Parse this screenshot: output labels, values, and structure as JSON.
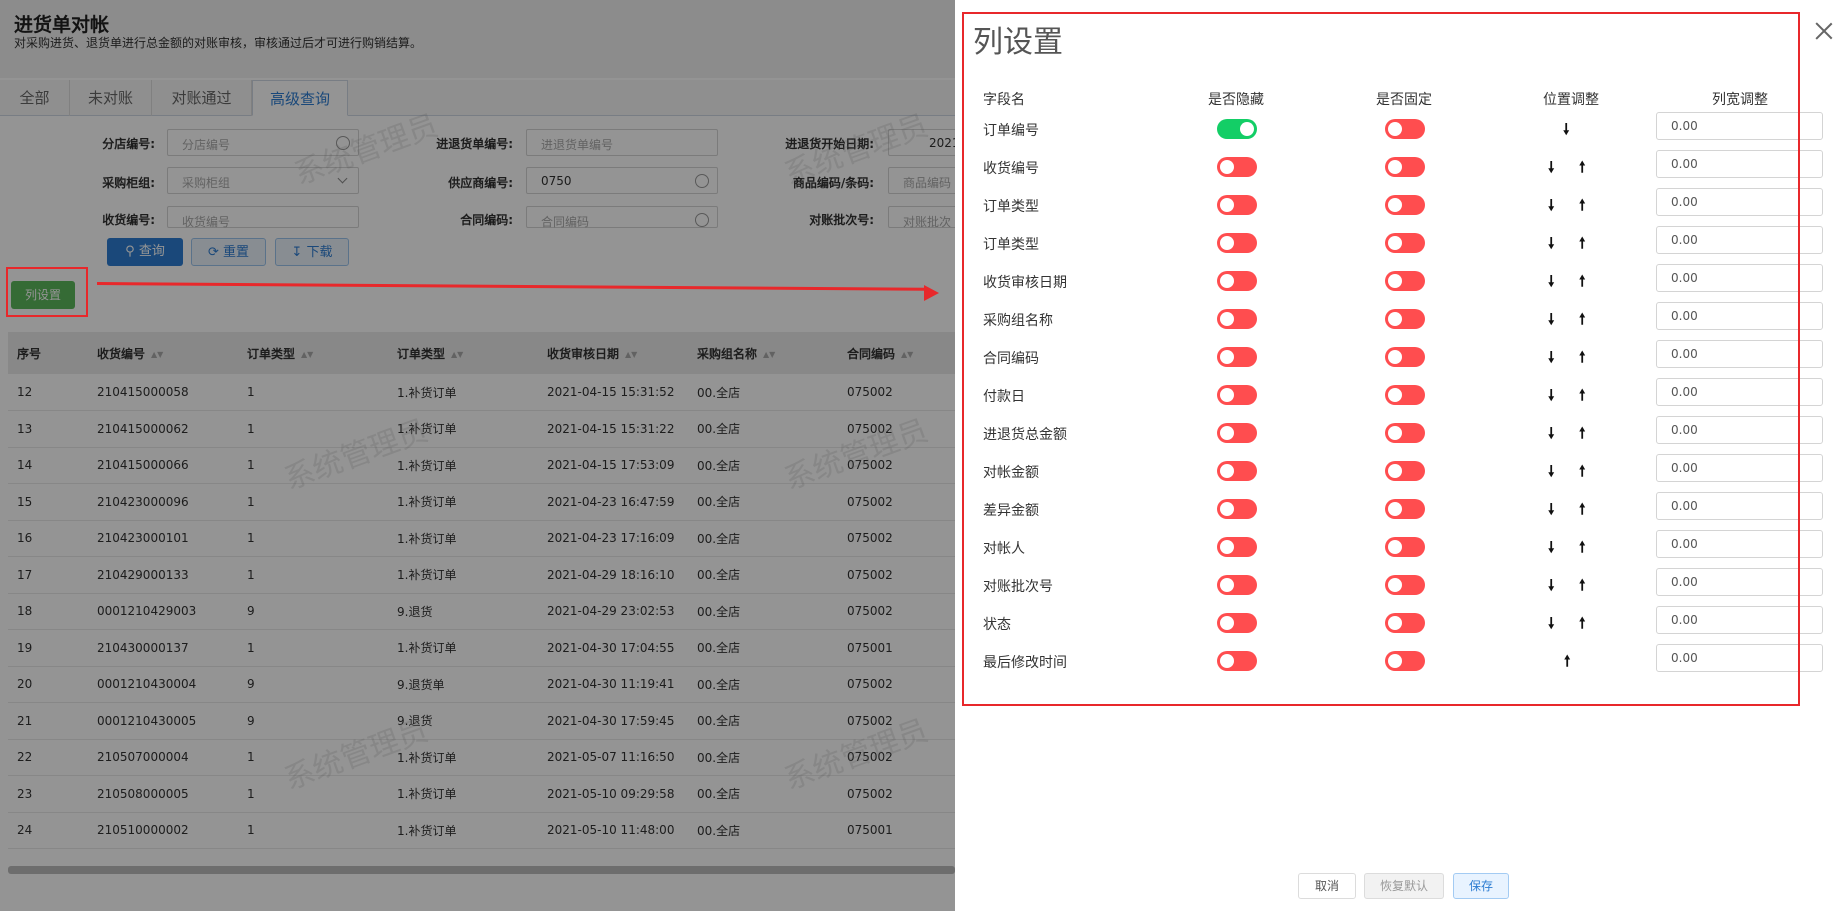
{
  "page": {
    "title": "进货单对帐",
    "description": "对采购进货、退货单进行总金额的对账审核，审核通过后才可进行购销结算。",
    "tabs": [
      {
        "label": "全部",
        "active": false
      },
      {
        "label": "未对账",
        "active": false
      },
      {
        "label": "对账通过",
        "active": false
      },
      {
        "label": "高级查询",
        "active": true
      }
    ],
    "filters": {
      "branch_no": {
        "label": "分店编号:",
        "placeholder": "分店编号"
      },
      "receipt_no_top": {
        "label": "进退货单编号:",
        "placeholder": "进退货单编号"
      },
      "start_date": {
        "label": "进退货开始日期:",
        "value": "2021"
      },
      "buyer_group": {
        "label": "采购柜组:",
        "placeholder": "采购柜组"
      },
      "supplier_no": {
        "label": "供应商编号:",
        "value": "0750"
      },
      "product_code": {
        "label": "商品编码/条码:",
        "placeholder": "商品编码"
      },
      "receipt_no": {
        "label": "收货编号:",
        "placeholder": "收货编号"
      },
      "contract_code": {
        "label": "合同编码:",
        "placeholder": "合同编码"
      },
      "batch_no": {
        "label": "对账批次号:",
        "placeholder": "对账批次"
      }
    },
    "buttons": {
      "query": "查询",
      "reset": "重置",
      "download": "下载",
      "column_settings": "列设置"
    },
    "watermark": "系统管理员",
    "table": {
      "headers": [
        "序号",
        "收货编号",
        "订单类型",
        "订单类型",
        "收货审核日期",
        "采购组名称",
        "合同编码"
      ],
      "rows": [
        [
          "12",
          "210415000058",
          "1",
          "1.补货订单",
          "2021-04-15 15:31:52",
          "00.全店",
          "075002"
        ],
        [
          "13",
          "210415000062",
          "1",
          "1.补货订单",
          "2021-04-15 15:31:22",
          "00.全店",
          "075002"
        ],
        [
          "14",
          "210415000066",
          "1",
          "1.补货订单",
          "2021-04-15 17:53:09",
          "00.全店",
          "075002"
        ],
        [
          "15",
          "210423000096",
          "1",
          "1.补货订单",
          "2021-04-23 16:47:59",
          "00.全店",
          "075002"
        ],
        [
          "16",
          "210423000101",
          "1",
          "1.补货订单",
          "2021-04-23 17:16:09",
          "00.全店",
          "075002"
        ],
        [
          "17",
          "210429000133",
          "1",
          "1.补货订单",
          "2021-04-29 18:16:10",
          "00.全店",
          "075002"
        ],
        [
          "18",
          "0001210429003",
          "9",
          "9.退货",
          "2021-04-29 23:02:53",
          "00.全店",
          "075002"
        ],
        [
          "19",
          "210430000137",
          "1",
          "1.补货订单",
          "2021-04-30 17:04:55",
          "00.全店",
          "075001"
        ],
        [
          "20",
          "0001210430004",
          "9",
          "9.退货单",
          "2021-04-30 11:19:41",
          "00.全店",
          "075002"
        ],
        [
          "21",
          "0001210430005",
          "9",
          "9.退货",
          "2021-04-30 17:59:45",
          "00.全店",
          "075002"
        ],
        [
          "22",
          "210507000004",
          "1",
          "1.补货订单",
          "2021-05-07 11:16:50",
          "00.全店",
          "075002"
        ],
        [
          "23",
          "210508000005",
          "1",
          "1.补货订单",
          "2021-05-10 09:29:58",
          "00.全店",
          "075002"
        ],
        [
          "24",
          "210510000002",
          "1",
          "1.补货订单",
          "2021-05-10 11:48:00",
          "00.全店",
          "075001"
        ]
      ]
    }
  },
  "drawer": {
    "title": "列设置",
    "headers": {
      "field": "字段名",
      "hidden": "是否隐藏",
      "fixed": "是否固定",
      "position": "位置调整",
      "width": "列宽调整"
    },
    "rows": [
      {
        "name": "订单编号",
        "hidden": true,
        "fixed": false,
        "down": true,
        "up": false,
        "width": "0.00"
      },
      {
        "name": "收货编号",
        "hidden": false,
        "fixed": false,
        "down": true,
        "up": true,
        "width": "0.00"
      },
      {
        "name": "订单类型",
        "hidden": false,
        "fixed": false,
        "down": true,
        "up": true,
        "width": "0.00"
      },
      {
        "name": "订单类型",
        "hidden": false,
        "fixed": false,
        "down": true,
        "up": true,
        "width": "0.00"
      },
      {
        "name": "收货审核日期",
        "hidden": false,
        "fixed": false,
        "down": true,
        "up": true,
        "width": "0.00"
      },
      {
        "name": "采购组名称",
        "hidden": false,
        "fixed": false,
        "down": true,
        "up": true,
        "width": "0.00"
      },
      {
        "name": "合同编码",
        "hidden": false,
        "fixed": false,
        "down": true,
        "up": true,
        "width": "0.00"
      },
      {
        "name": "付款日",
        "hidden": false,
        "fixed": false,
        "down": true,
        "up": true,
        "width": "0.00"
      },
      {
        "name": "进退货总金额",
        "hidden": false,
        "fixed": false,
        "down": true,
        "up": true,
        "width": "0.00"
      },
      {
        "name": "对帐金额",
        "hidden": false,
        "fixed": false,
        "down": true,
        "up": true,
        "width": "0.00"
      },
      {
        "name": "差异金额",
        "hidden": false,
        "fixed": false,
        "down": true,
        "up": true,
        "width": "0.00"
      },
      {
        "name": "对帐人",
        "hidden": false,
        "fixed": false,
        "down": true,
        "up": true,
        "width": "0.00"
      },
      {
        "name": "对账批次号",
        "hidden": false,
        "fixed": false,
        "down": true,
        "up": true,
        "width": "0.00"
      },
      {
        "name": "状态",
        "hidden": false,
        "fixed": false,
        "down": true,
        "up": true,
        "width": "0.00"
      },
      {
        "name": "最后修改时间",
        "hidden": false,
        "fixed": false,
        "down": false,
        "up": true,
        "width": "0.00"
      }
    ],
    "arrow_glyphs": {
      "down": "🠗",
      "up": "🠕"
    },
    "buttons": {
      "cancel": "取消",
      "restore": "恢复默认",
      "save": "保存"
    }
  },
  "colors": {
    "switch_on": "#13ce66",
    "switch_off": "#ff4d4f",
    "annotation": "#e8282b",
    "primary": "#2d7dd2"
  }
}
